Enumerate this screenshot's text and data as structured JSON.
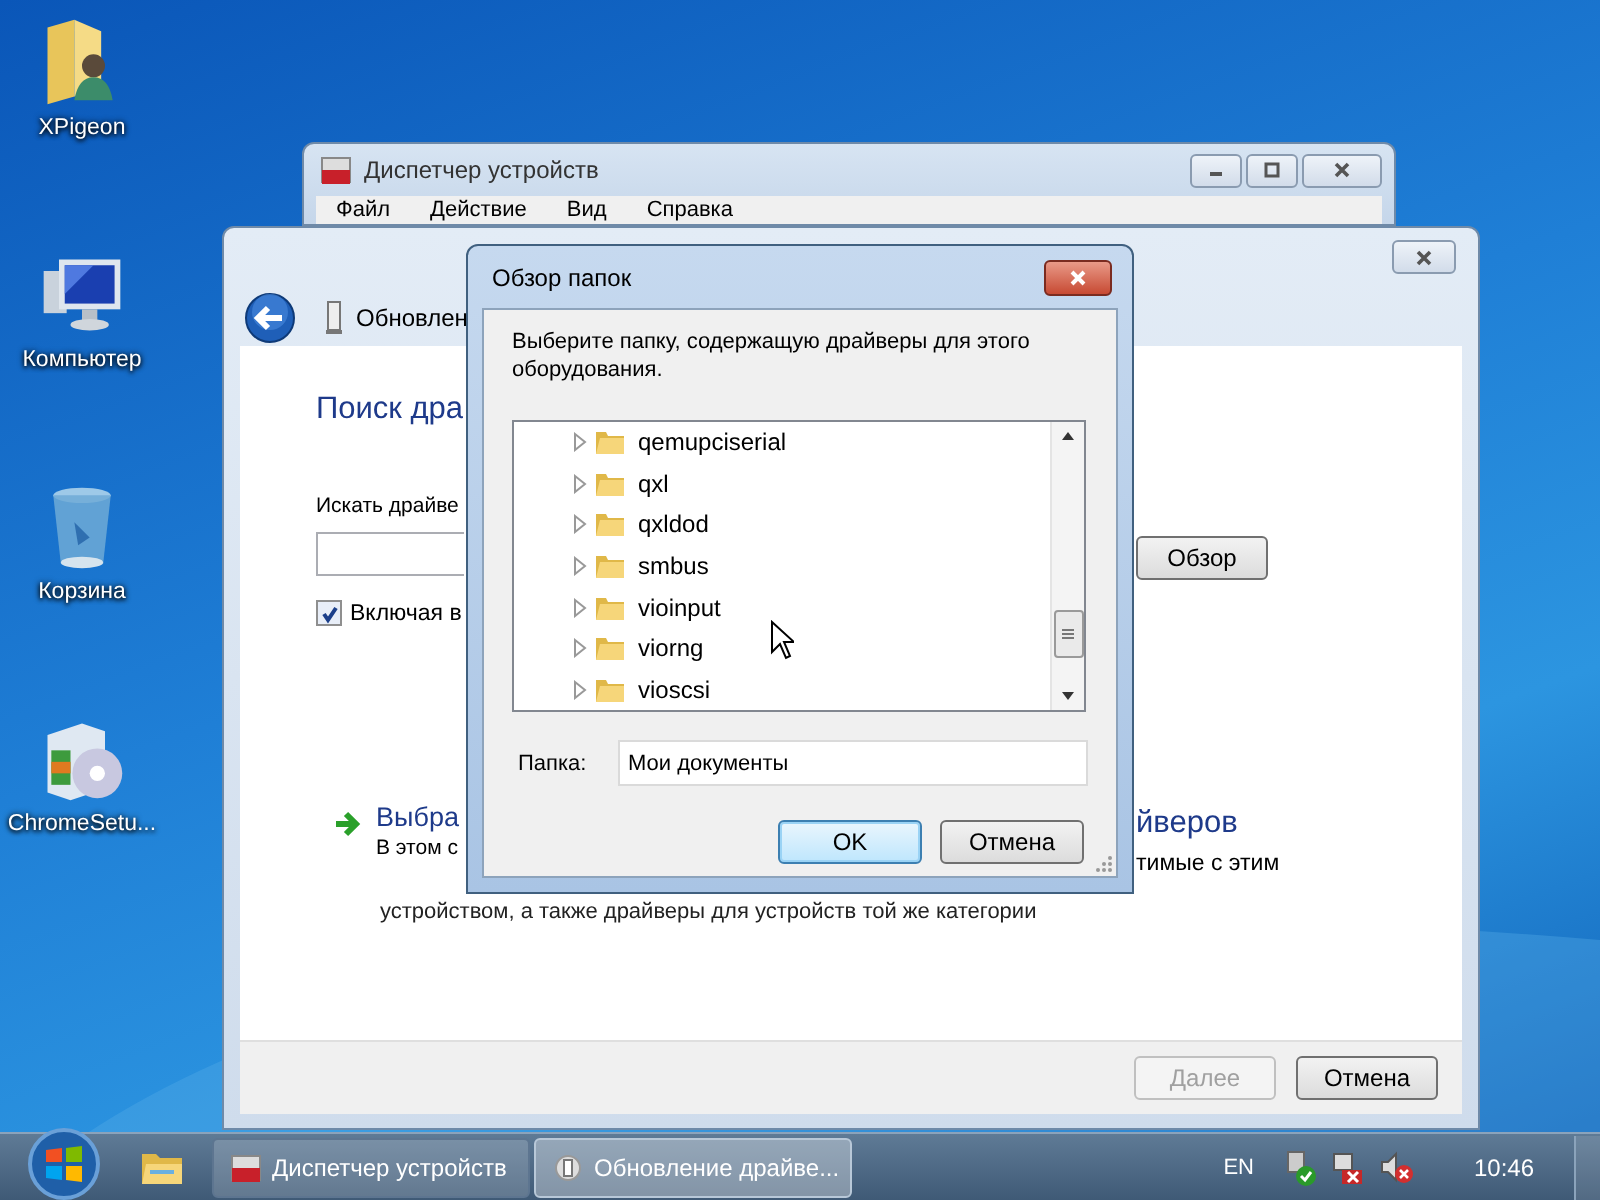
{
  "desktop_icons": [
    {
      "label": "XPigeon"
    },
    {
      "label": "Компьютер"
    },
    {
      "label": "Корзина"
    },
    {
      "label": "ChromeSetu..."
    }
  ],
  "background_window": {
    "title": "Диспетчер устройств",
    "menu": [
      "Файл",
      "Действие",
      "Вид",
      "Справка"
    ]
  },
  "wizard": {
    "title": "Обновлен",
    "heading": "Поиск дра",
    "search_label": "Искать драйве",
    "browse_button": "Обзор",
    "include_subfolders": {
      "label": "Включая в",
      "checked": true
    },
    "option": {
      "title_start": "Выбра",
      "title_end": "йверов",
      "text_start": "В этом с",
      "text_end": "тимые с этим",
      "text_line_2": "устройством, а также драйверы для устройств той же категории"
    },
    "buttons": [
      {
        "label": "Далее",
        "disabled": true
      },
      {
        "label": "Отмена",
        "disabled": false
      }
    ]
  },
  "dialog": {
    "title": "Обзор папок",
    "prompt": "Выберите папку, содержащую драйверы для этого оборудования.",
    "folders": [
      {
        "name": "qemupciserial",
        "expanded": false
      },
      {
        "name": "qxl",
        "expanded": false
      },
      {
        "name": "qxldod",
        "expanded": false
      },
      {
        "name": "smbus",
        "expanded": false
      },
      {
        "name": "vioinput",
        "expanded": false
      },
      {
        "name": "viorng",
        "expanded": false
      },
      {
        "name": "vioscsi",
        "expanded": false
      }
    ],
    "folder_label": "Папка:",
    "folder_value": "Мои документы",
    "buttons": [
      {
        "label": "OK",
        "default": true
      },
      {
        "label": "Отмена",
        "default": false
      }
    ]
  },
  "taskbar": {
    "tasks": [
      {
        "label": "Диспетчер устройств",
        "selected": false
      },
      {
        "label": "Обновление драйве...",
        "selected": true
      }
    ],
    "language": "EN",
    "clock": "10:46"
  }
}
